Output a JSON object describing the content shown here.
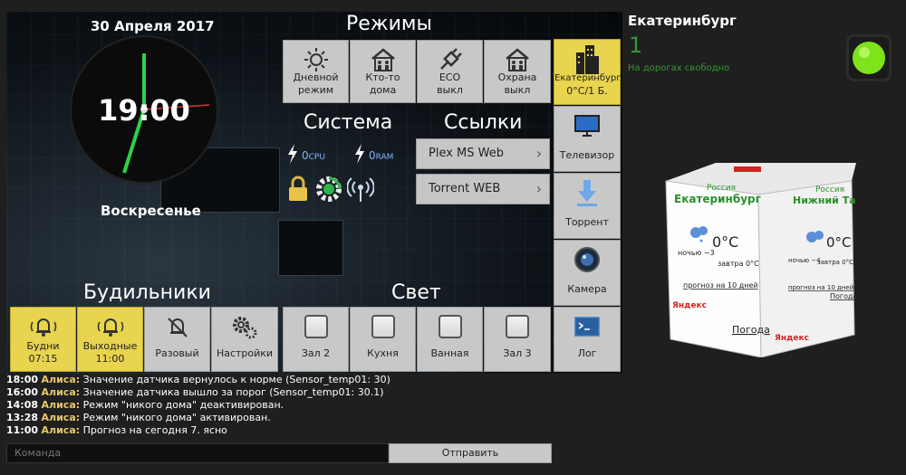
{
  "dashboard": {
    "date": "30 Апреля 2017",
    "time": "19:00",
    "weekday": "Воскресенье",
    "sections": {
      "modes": "Режимы",
      "system": "Система",
      "links": "Ссылки",
      "alarms": "Будильники",
      "light": "Свет"
    },
    "modes": [
      {
        "label1": "Дневной",
        "label2": "режим",
        "icon": "sun-icon"
      },
      {
        "label1": "Кто-то",
        "label2": "дома",
        "icon": "family-home-icon"
      },
      {
        "label1": "ECO",
        "label2": "выкл",
        "icon": "plug-icon"
      },
      {
        "label1": "Охрана",
        "label2": "выкл",
        "icon": "security-home-icon"
      }
    ],
    "system": {
      "cpu_value": "0",
      "cpu_unit": "CPU",
      "ram_value": "0",
      "ram_unit": "RAM"
    },
    "links": [
      {
        "label": "Plex MS Web"
      },
      {
        "label": "Torrent WEB"
      }
    ],
    "alarms": [
      {
        "label1": "Будни",
        "label2": "07:15",
        "active": true,
        "icon": "alarm-bell-icon"
      },
      {
        "label1": "Выходные",
        "label2": "11:00",
        "active": true,
        "icon": "alarm-bell-icon"
      },
      {
        "label1": "Разовый",
        "label2": "",
        "active": false,
        "icon": "bell-off-icon"
      },
      {
        "label1": "Настройки",
        "label2": "",
        "active": false,
        "icon": "gears-icon"
      }
    ],
    "lights": [
      {
        "label": "Зал 2"
      },
      {
        "label": "Кухня"
      },
      {
        "label": "Ванная"
      },
      {
        "label": "Зал 3"
      }
    ],
    "side": [
      {
        "label1": "Екатеринбург",
        "label2": "0°C/1 Б.",
        "active": true,
        "icon": "city-buildings-icon"
      },
      {
        "label1": "Телевизор",
        "label2": "",
        "active": false,
        "icon": "tv-icon"
      },
      {
        "label1": "Торрент",
        "label2": "",
        "active": false,
        "icon": "download-icon"
      },
      {
        "label1": "Камера",
        "label2": "",
        "active": false,
        "icon": "camera-icon"
      },
      {
        "label1": "Лог",
        "label2": "",
        "active": false,
        "icon": "terminal-icon"
      }
    ],
    "log": [
      {
        "time": "18:00",
        "who": "Алиса:",
        "text": "Значение датчика вернулось к норме (Sensor_temp01: 30)"
      },
      {
        "time": "16:00",
        "who": "Алиса:",
        "text": "Значение датчика вышло за порог (Sensor_temp01: 30.1)"
      },
      {
        "time": "14:08",
        "who": "Алиса:",
        "text": "Режим \"никого дома\" деактивирован."
      },
      {
        "time": "13:28",
        "who": "Алиса:",
        "text": "Режим \"никого дома\" активирован."
      },
      {
        "time": "11:00",
        "who": "Алиса:",
        "text": "Прогноз на сегодня 7. ясно"
      }
    ],
    "command_placeholder": "Команда",
    "send_label": "Отправить"
  },
  "traffic": {
    "city": "Екатеринбург",
    "level": "1",
    "status": "На дорогах свободно"
  },
  "weather_cube": {
    "left": {
      "country": "Россия",
      "city": "Екатеринбург",
      "temp": "0°C",
      "night": "ночью −3",
      "tomorrow": "завтра 0°C",
      "forecast": "прогноз на 10 дней",
      "brand": "Яндекс",
      "weather": "Погода"
    },
    "right": {
      "country": "Россия",
      "city": "Нижний Тагил",
      "temp": "0°C",
      "night": "ночью −4",
      "tomorrow": "завтра 0°C",
      "forecast": "прогноз на 10 дней",
      "brand": "Яндекс",
      "weather": "Погода"
    }
  },
  "colors": {
    "active_tile": "#e8d44f",
    "tile": "#c8c8c8",
    "link_blue": "#7fb2ff",
    "traffic_green": "#2f9a2f",
    "log_name": "#e8c66a"
  }
}
